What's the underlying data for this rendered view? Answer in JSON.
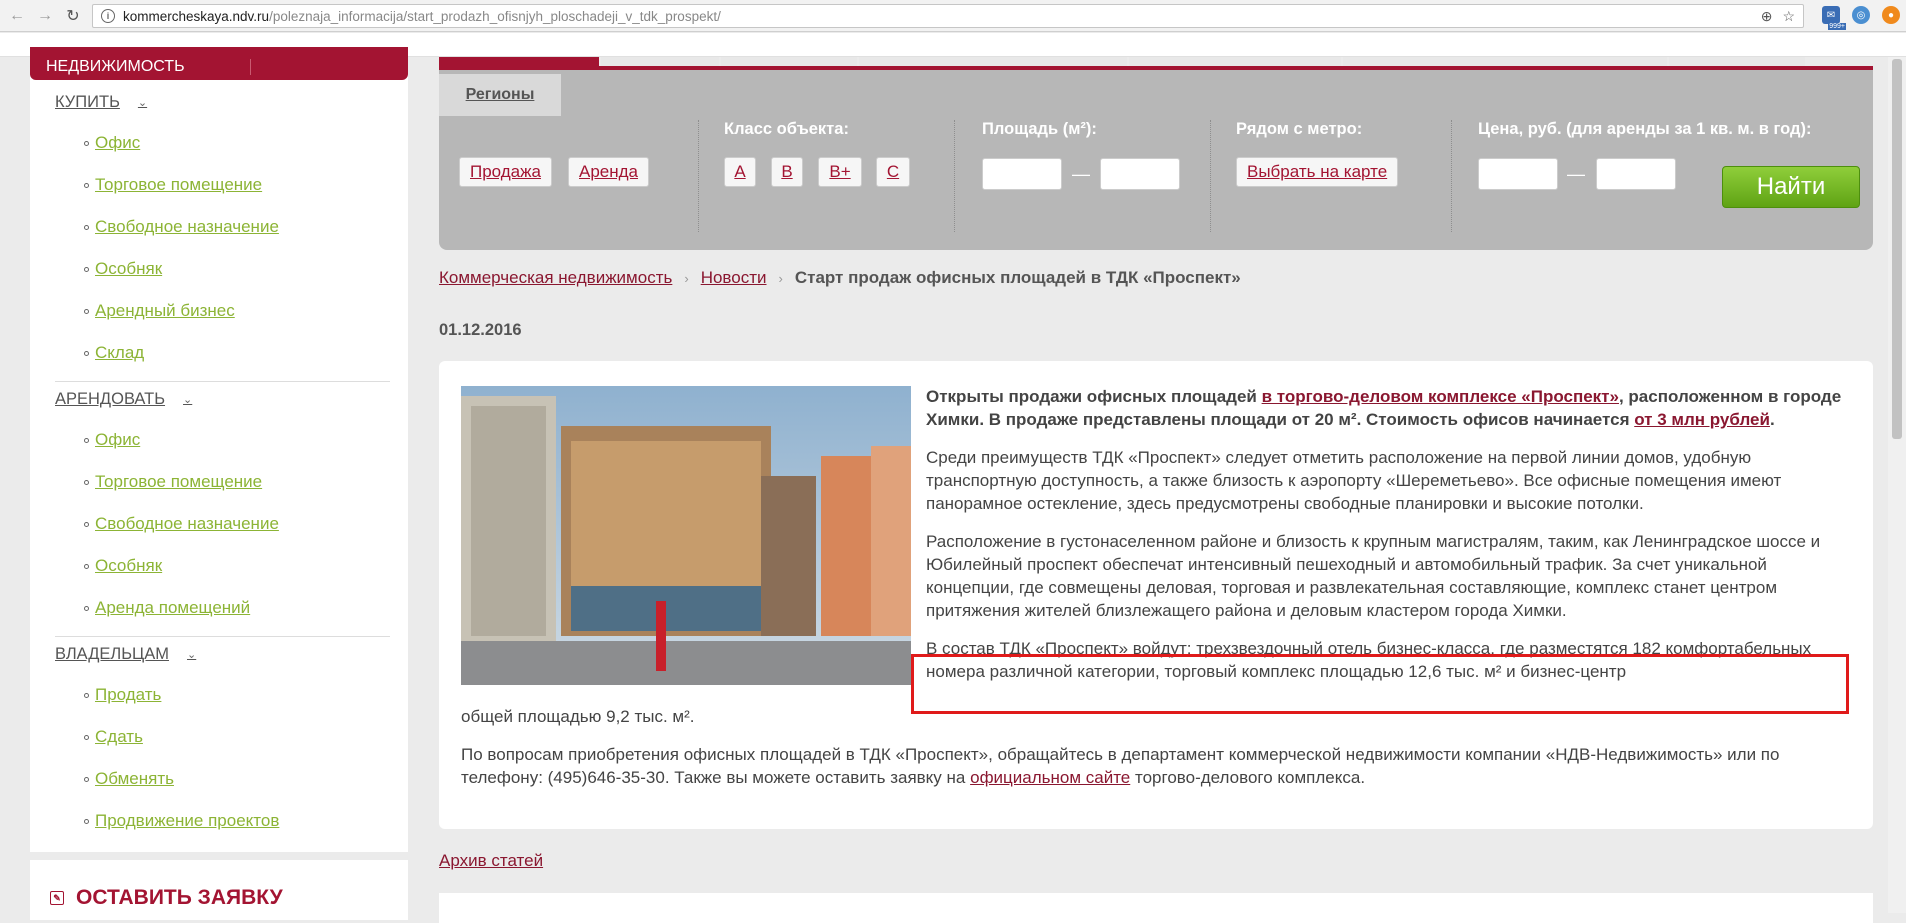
{
  "browser": {
    "url_host": "kommercheskaya.ndv.ru",
    "url_path": "/poleznaja_informacija/start_prodazh_ofisnjyh_ploschadeji_v_tdk_prospekt/",
    "ext_badge": "999+"
  },
  "sidebar": {
    "header": "Недвижимость",
    "groups": [
      {
        "title": "Купить",
        "items": [
          "Офис",
          "Торговое помещение",
          "Свободное назначение",
          "Особняк",
          "Арендный бизнес",
          "Склад"
        ]
      },
      {
        "title": "Арендовать",
        "items": [
          "Офис",
          "Торговое помещение",
          "Свободное назначение",
          "Особняк",
          "Аренда помещений"
        ]
      },
      {
        "title": "Владельцам",
        "items": [
          "Продать",
          "Сдать",
          "Обменять",
          "Продвижение проектов"
        ]
      }
    ],
    "cta": "Оставить заявку"
  },
  "search": {
    "tab_label": "Регионы",
    "deal_label": "",
    "deal_options": [
      "Продажа",
      "Аренда"
    ],
    "class_label": "Класс объекта:",
    "class_options": [
      "A",
      "B",
      "B+",
      "C"
    ],
    "area_label": "Площадь (м²):",
    "metro_label": "Рядом с метро:",
    "metro_button": "Выбрать на карте",
    "price_label": "Цена, руб. (для аренды за 1 кв. м. в год):",
    "dash": "—",
    "find_button": "Найти"
  },
  "breadcrumb": {
    "items": [
      "Коммерческая недвижимость",
      "Новости"
    ],
    "current": "Старт продаж офисных площадей в ТДК «Проспект»"
  },
  "article": {
    "date": "01.12.2016",
    "lead_1": "Открыты продажи офисных площадей ",
    "lead_link": "в торгово-деловом комплексе «Проспект»",
    "lead_2": ", расположенном в городе Химки. В продаже представлены площади от 20 м². Стоимость офисов начинается ",
    "lead_link2": "от 3 млн рублей",
    "lead_3": ".",
    "p2": "Среди преимуществ ТДК «Проспект» следует отметить расположение на первой линии домов, удобную транспортную доступность, а также близость к аэропорту «Шереметьево». Все офисные помещения имеют панорамное остекление, здесь предусмотрены свободные планировки и высокие потолки.",
    "p3": "Расположение в густонаселенном районе и близость к крупным магистралям, таким, как Ленинградское шоссе и Юбилейный проспект обеспечат интенсивный пешеходный и автомобильный трафик. За счет уникальной концепции, где совмещены деловая, торговая и развлекательная составляющие, комплекс станет центром притяжения жителей близлежащего района и деловым кластером города Химки.",
    "p4": "В состав ТДК «Проспект» войдут: трехзвездочный отель бизнес-класса, где разместятся 182 комфортабельных номера различной категории, торговый комплекс площадью 12,6 тыс. м² и бизнес-центр",
    "p4_tail": "общей площадью 9,2 тыс. м².",
    "p5_1": "По вопросам приобретения офисных площадей в ТДК «Проспект», обращайтесь в департамент коммерческой недвижимости компании «НДВ-Недвижимость» или по телефону: (495)646-35-30. Также вы можете оставить заявку на ",
    "p5_link": "официальном сайте",
    "p5_2": " торгово-делового комплекса."
  },
  "archive_link": "Архив статей",
  "colors": {
    "brand": "#a31432",
    "menu_link": "#8cb435",
    "find_button": "#6db222",
    "highlight": "#e01a1a"
  }
}
